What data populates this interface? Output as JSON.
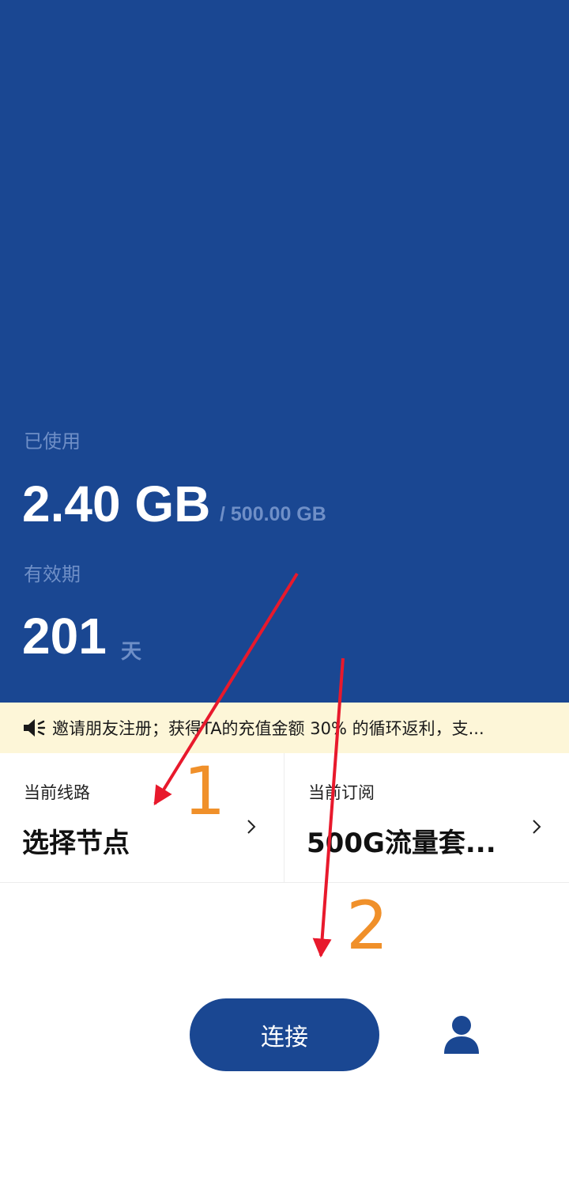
{
  "usage": {
    "used_label": "已使用",
    "used_value": "2.40 GB",
    "total": "/ 500.00 GB",
    "valid_label": "有效期",
    "days_value": "201",
    "days_unit": "天"
  },
  "notice": {
    "icon": "speaker-icon",
    "text": "邀请朋友注册；获得TA的充值金额 30% 的循环返利，支..."
  },
  "cards": {
    "route": {
      "label": "当前线路",
      "value": "选择节点"
    },
    "subscription": {
      "label": "当前订阅",
      "value": "500G流量套..."
    }
  },
  "actions": {
    "connect_label": "连接",
    "profile_icon": "user-icon"
  },
  "annotations": {
    "step1": "1",
    "step2": "2"
  },
  "colors": {
    "primary": "#1a4792",
    "notice_bg": "#fdf6d8",
    "arrow": "#e8192c",
    "step_number": "#f0902a"
  }
}
